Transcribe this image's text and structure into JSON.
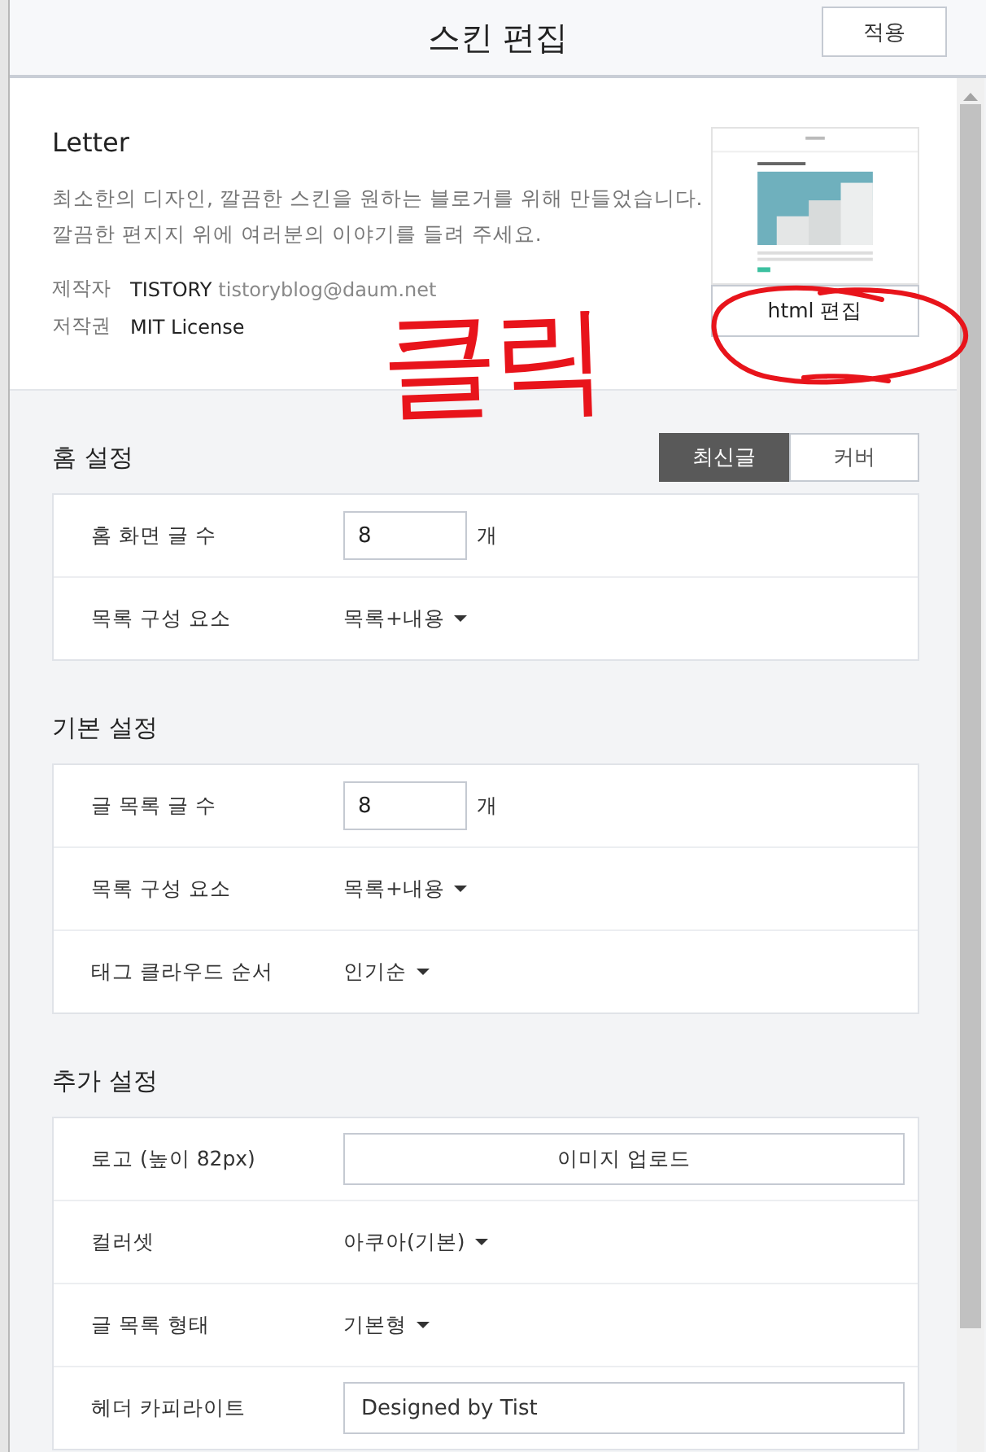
{
  "header": {
    "title": "스킨 편집",
    "apply_button": "적용"
  },
  "skin": {
    "name": "Letter",
    "description": [
      "최소한의 디자인, 깔끔한 스킨을 원하는 블로거를 위해 만들었습니다.",
      "깔끔한 편지지 위에 여러분의 이야기를 들려 주세요."
    ],
    "meta": [
      {
        "label": "제작자",
        "value": "TISTORY",
        "extra": "tistoryblog@daum.net"
      },
      {
        "label": "저작권",
        "value": "MIT License"
      }
    ],
    "preview": {
      "kind": "picture"
    },
    "edit_button": "html 편집"
  },
  "annotation": {
    "text": "클릭"
  },
  "sections": [
    {
      "title": "홈 설정",
      "toggle": [
        {
          "label": "최신글",
          "selected": true
        },
        {
          "label": "커버",
          "selected": false
        }
      ],
      "rows": [
        {
          "kind": "number",
          "label": "홈 화면 글 수",
          "value": "8",
          "unit": "개"
        },
        {
          "kind": "select",
          "label": "목록 구성 요소",
          "value": "목록+내용"
        }
      ]
    },
    {
      "title": "기본 설정",
      "rows": [
        {
          "kind": "number",
          "label": "글 목록 글 수",
          "value": "8",
          "unit": "개"
        },
        {
          "kind": "select",
          "label": "목록 구성 요소",
          "value": "목록+내용"
        },
        {
          "kind": "select",
          "label": "태그 클라우드 순서",
          "value": "인기순"
        }
      ]
    },
    {
      "title": "추가 설정",
      "rows": [
        {
          "kind": "upload",
          "label": "로고 (높이 82px)",
          "value": "이미지 업로드"
        },
        {
          "kind": "select",
          "label": "컬러셋",
          "value": "아쿠아(기본)"
        },
        {
          "kind": "select",
          "label": "글 목록 형태",
          "value": "기본형"
        },
        {
          "kind": "text",
          "label": "헤더 카피라이트",
          "value": "Designed by Tist"
        }
      ]
    }
  ]
}
